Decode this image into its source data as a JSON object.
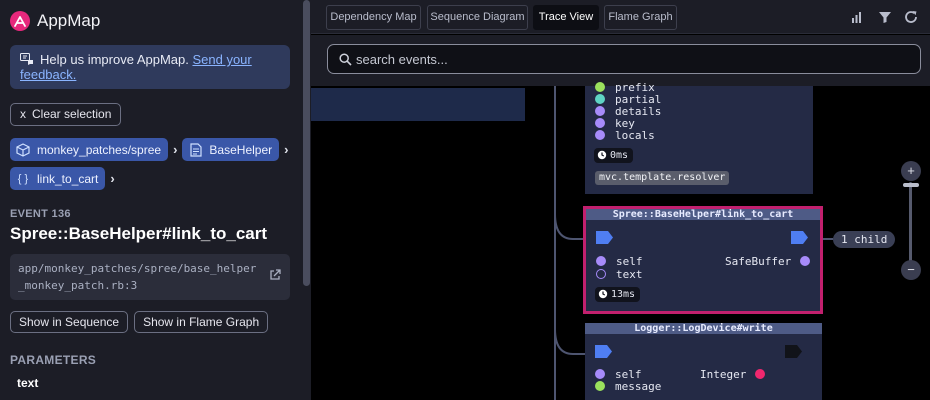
{
  "app": {
    "title": "AppMap"
  },
  "feedback": {
    "text": "Help us improve AppMap. ",
    "link": "Send your feedback."
  },
  "clear_selection": {
    "icon": "x",
    "label": "Clear selection"
  },
  "breadcrumbs": [
    {
      "icon": "package-icon",
      "label": "monkey_patches/spree"
    },
    {
      "icon": "class-icon",
      "label": "BaseHelper"
    },
    {
      "icon": "braces-icon",
      "icon_text": "{ }",
      "label": "link_to_cart"
    }
  ],
  "event": {
    "label": "EVENT 136",
    "title": "Spree::BaseHelper#link_to_cart",
    "path": "app/monkey_patches/spree/base_helper_monkey_patch.rb:3",
    "show_in_sequence": "Show in Sequence",
    "show_in_flame_graph": "Show in Flame Graph"
  },
  "parameters": {
    "label": "PARAMETERS",
    "items": [
      "text"
    ]
  },
  "tabs": [
    {
      "label": "Dependency Map",
      "active": false
    },
    {
      "label": "Sequence Diagram",
      "active": false
    },
    {
      "label": "Trace View",
      "active": true
    },
    {
      "label": "Flame Graph",
      "active": false
    }
  ],
  "tools": [
    "bar-chart-icon",
    "filter-icon",
    "refresh-icon"
  ],
  "search": {
    "placeholder": "search events..."
  },
  "colors": {
    "accent": "#e7287c",
    "selected_border": "#c2206e",
    "dot_purple": "#a78bfa",
    "dot_green": "#9be15d",
    "dot_teal": "#5fd4c4",
    "dot_red": "#f0276e"
  },
  "trace": {
    "prev_node": {
      "params": [
        {
          "name": "prefix",
          "color": "green"
        },
        {
          "name": "partial",
          "color": "teal"
        },
        {
          "name": "details",
          "color": "purple"
        },
        {
          "name": "key",
          "color": "purple"
        },
        {
          "name": "locals",
          "color": "purple"
        }
      ],
      "duration": "0ms",
      "label": "mvc.template.resolver"
    },
    "selected_node": {
      "title": "Spree::BaseHelper#link_to_cart",
      "params": [
        {
          "name": "self",
          "color": "purple"
        },
        {
          "name": "text",
          "color": "hollow"
        }
      ],
      "return_value": "SafeBuffer",
      "duration": "13ms",
      "children": "1 child"
    },
    "next_node": {
      "title": "Logger::LogDevice#write",
      "params": [
        {
          "name": "self",
          "color": "purple"
        },
        {
          "name": "message",
          "color": "green"
        }
      ],
      "return_value": "Integer"
    }
  },
  "zoom": {
    "plus": "+",
    "minus": "−"
  }
}
